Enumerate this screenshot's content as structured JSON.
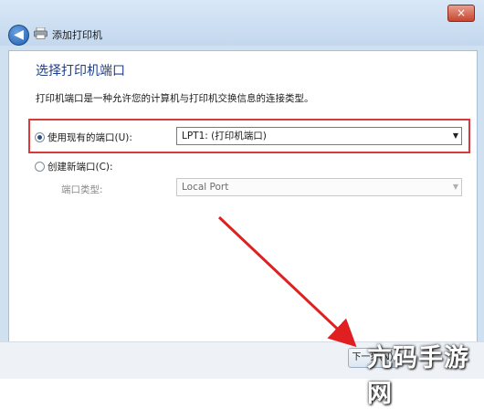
{
  "window": {
    "close_glyph": "×",
    "back_glyph": "◀",
    "title": "添加打印机"
  },
  "page": {
    "heading": "选择打印机端口",
    "description": "打印机端口是一种允许您的计算机与打印机交换信息的连接类型。"
  },
  "existing_port": {
    "label": "使用现有的端口(U):",
    "selected": true,
    "value": "LPT1: (打印机端口)"
  },
  "new_port": {
    "label": "创建新端口(C):",
    "selected": false,
    "type_label": "端口类型:",
    "type_value": "Local Port"
  },
  "footer": {
    "next_label": "下一步(N)"
  },
  "annotation": {
    "highlight_color": "#d83a3a",
    "arrow_color": "#e02020"
  },
  "watermark": "亢码手游网"
}
